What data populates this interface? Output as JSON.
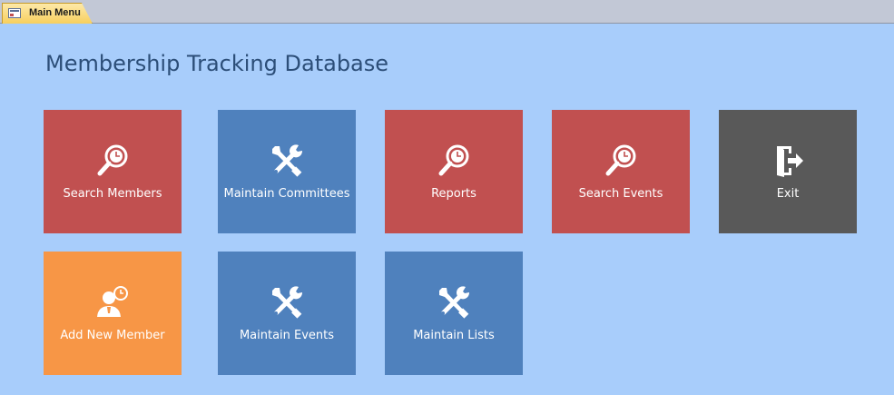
{
  "tab": {
    "label": "Main Menu"
  },
  "title": "Membership Tracking Database",
  "colors": {
    "background": "#a8cdfb",
    "red_tile": "#c15050",
    "blue_tile": "#4f81bd",
    "gray_tile": "#595959",
    "orange_tile": "#f79646"
  },
  "tiles": [
    {
      "label": "Search Members",
      "icon": "search-clock-icon",
      "color": "#c15050"
    },
    {
      "label": "Maintain Committees",
      "icon": "tools-icon",
      "color": "#4f81bd"
    },
    {
      "label": "Reports",
      "icon": "search-clock-icon",
      "color": "#c15050"
    },
    {
      "label": "Search Events",
      "icon": "search-clock-icon",
      "color": "#c15050"
    },
    {
      "label": "Exit",
      "icon": "exit-door-icon",
      "color": "#595959"
    },
    {
      "label": "Add New Member",
      "icon": "add-member-icon",
      "color": "#f79646"
    },
    {
      "label": "Maintain Events",
      "icon": "tools-icon",
      "color": "#4f81bd"
    },
    {
      "label": "Maintain Lists",
      "icon": "tools-icon",
      "color": "#4f81bd"
    }
  ]
}
